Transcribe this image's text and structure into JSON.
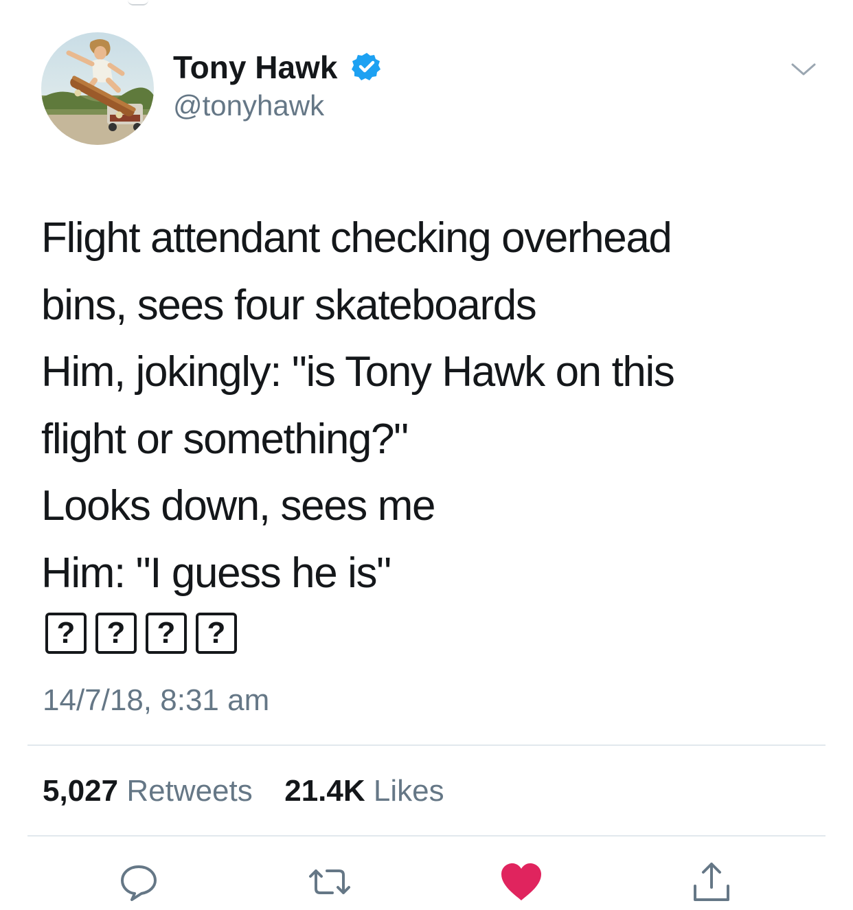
{
  "author": {
    "display_name": "Tony Hawk",
    "handle": "@tonyhawk",
    "verified": true
  },
  "tweet": {
    "lines": [
      "Flight attendant checking overhead",
      "bins, sees four skateboards",
      "Him, jokingly: \"is Tony Hawk on this",
      "flight or something?\"",
      "Looks down, sees me",
      "Him: \"I guess he is\""
    ],
    "emoji": [
      "?",
      "?",
      "?",
      "?"
    ],
    "timestamp": "14/7/18, 8:31 am"
  },
  "stats": {
    "retweets_count": "5,027",
    "retweets_label": "Retweets",
    "likes_count": "21.4K",
    "likes_label": "Likes"
  },
  "actions": {
    "reply_icon": "reply-bubble-icon",
    "retweet_icon": "retweet-arrows-icon",
    "like_icon": "heart-icon",
    "share_icon": "share-upload-icon",
    "liked": true
  },
  "colors": {
    "text_primary": "#14171a",
    "text_secondary": "#657786",
    "verified_blue": "#1da1f2",
    "like_red": "#e0245e",
    "divider": "#e1e8ed"
  }
}
